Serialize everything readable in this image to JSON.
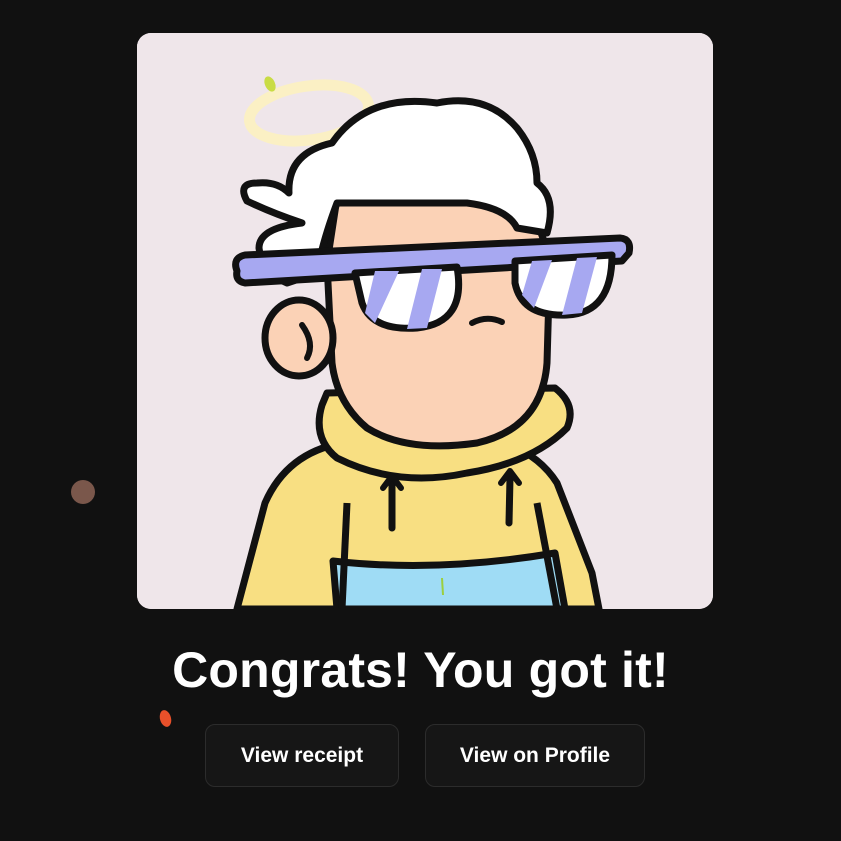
{
  "artwork": {
    "icon": "avatar-character-illustration",
    "background_color": "#efe6ea"
  },
  "message": {
    "title": "Congrats! You got it!"
  },
  "actions": {
    "receipt_label": "View receipt",
    "profile_label": "View on Profile"
  },
  "colors": {
    "page_background": "#111111",
    "button_background": "#161616",
    "text": "#ffffff",
    "confetti_brown": "#7a574b",
    "confetti_orange": "#e8502a"
  }
}
